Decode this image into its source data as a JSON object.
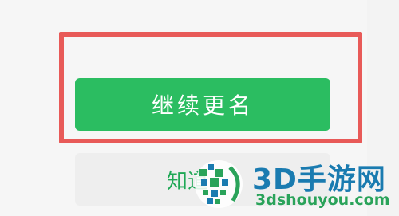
{
  "dialog": {
    "primary_button_label": "继续更名",
    "secondary_button_label": "知道",
    "highlight_color": "#e85a58",
    "primary_color": "#2bbd61"
  },
  "watermark": {
    "title": "3D手游网",
    "url": "3dshouyou.com",
    "logo_icon": "3d-shouyou-logo-icon"
  }
}
